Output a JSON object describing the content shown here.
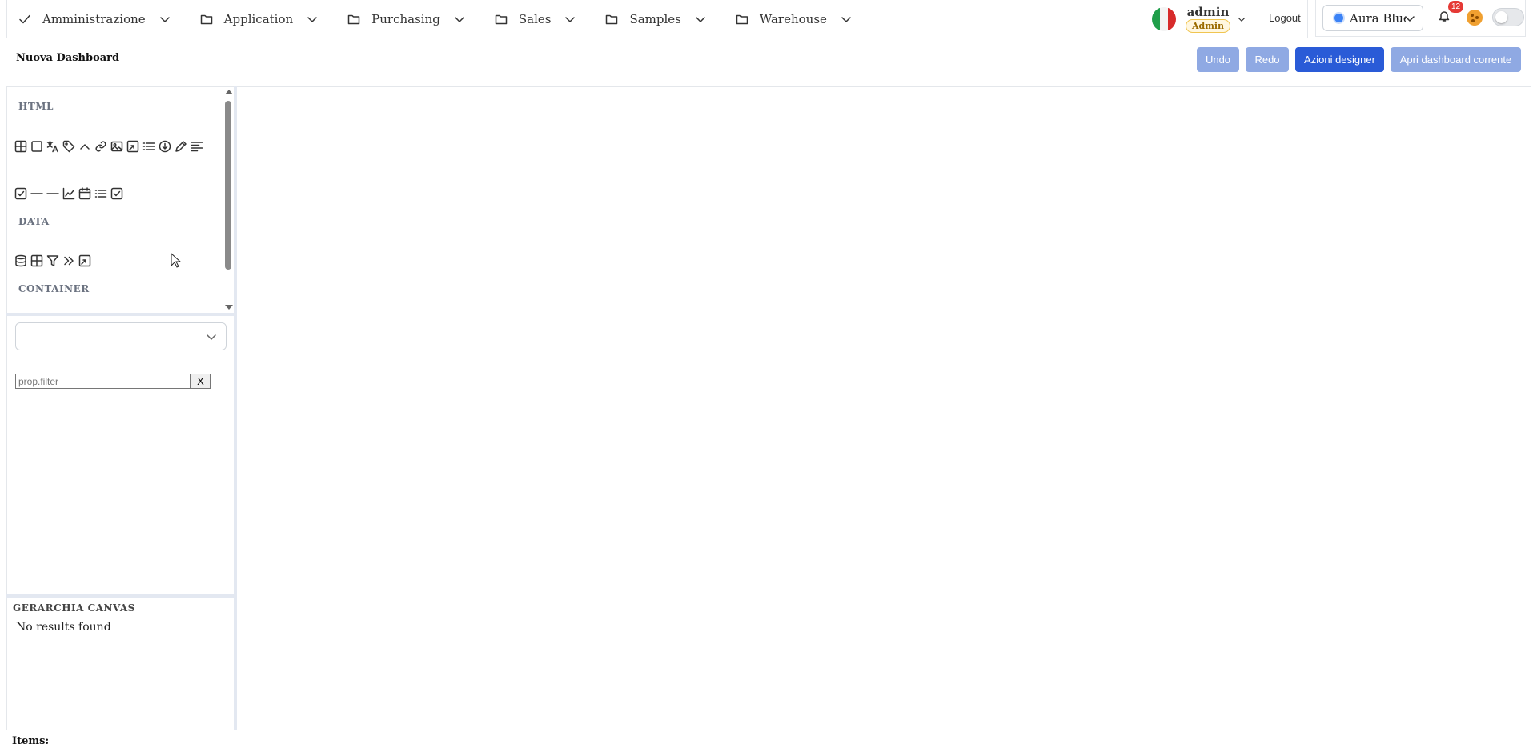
{
  "nav": {
    "items": [
      {
        "label": "Amministrazione",
        "icon": "check-icon"
      },
      {
        "label": "Application",
        "icon": "folder-icon"
      },
      {
        "label": "Purchasing",
        "icon": "folder-icon"
      },
      {
        "label": "Sales",
        "icon": "folder-icon"
      },
      {
        "label": "Samples",
        "icon": "folder-icon"
      },
      {
        "label": "Warehouse",
        "icon": "folder-icon"
      }
    ],
    "user": {
      "name": "admin",
      "role": "Admin",
      "language_flag": "italy-flag-icon"
    },
    "logout_label": "Logout",
    "theme": {
      "label": "Aura Blue",
      "dot_color": "#3b82f6"
    },
    "notifications": {
      "count": "12"
    }
  },
  "page": {
    "title": "Nuova Dashboard"
  },
  "toolbar": {
    "undo_label": "Undo",
    "redo_label": "Redo",
    "actions_label": "Azioni designer",
    "open_label": "Apri dashboard corrente"
  },
  "toolbox": {
    "sections": [
      {
        "title": "HTML",
        "icons": [
          "table-icon",
          "square-icon",
          "translate-icon",
          "tag-icon",
          "chevron-up-icon",
          "link-icon",
          "image-icon",
          "external-link-icon",
          "list-icon",
          "download-circle-icon",
          "pencil-icon",
          "align-left-icon",
          "checkbox-icon",
          "minus-icon",
          "minus-icon",
          "chart-line-icon",
          "calendar-icon",
          "list-icon",
          "checkbox-icon"
        ]
      },
      {
        "title": "DATA",
        "icons": [
          "database-icon",
          "table-icon",
          "filter-icon",
          "chevrons-right-icon",
          "external-link-icon"
        ]
      },
      {
        "title": "CONTAINER",
        "icons": []
      }
    ]
  },
  "properties": {
    "selected": "",
    "filter_placeholder": "prop.filter",
    "clear_label": "X"
  },
  "hierarchy": {
    "title": "GERARCHIA CANVAS",
    "empty_text": "No results found"
  },
  "footer": {
    "items_label": "Items:"
  },
  "colors": {
    "primary": "#2a5bd7",
    "primary_light": "#8fa9e3",
    "badge_red": "#e53935"
  }
}
